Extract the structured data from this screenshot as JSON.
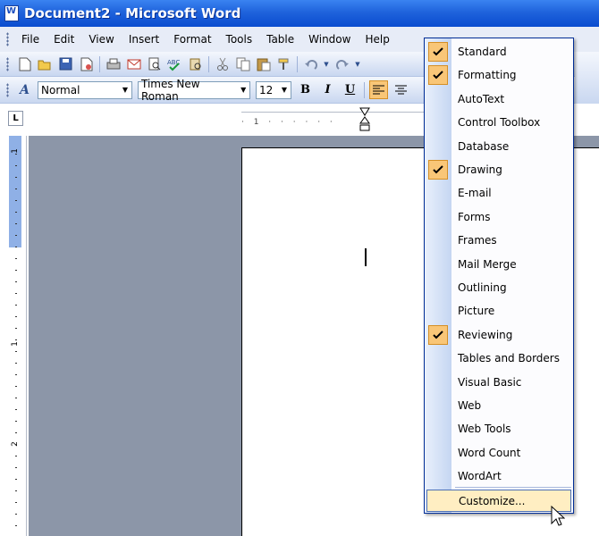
{
  "window": {
    "title": "Document2 - Microsoft Word"
  },
  "menubar": {
    "items": [
      "File",
      "Edit",
      "View",
      "Insert",
      "Format",
      "Tools",
      "Table",
      "Window",
      "Help"
    ]
  },
  "standard_toolbar": {
    "icons": [
      "new-icon",
      "open-icon",
      "save-icon",
      "permission-icon",
      "print-icon",
      "email-icon",
      "print-preview-icon",
      "spelling-icon",
      "research-icon",
      "cut-icon",
      "copy-icon",
      "paste-icon",
      "format-painter-icon",
      "undo-icon",
      "redo-icon"
    ]
  },
  "formatting_toolbar": {
    "style_value": "Normal",
    "font_value": "Times New Roman",
    "size_value": "12",
    "bold_label": "B",
    "italic_label": "I",
    "underline_label": "U"
  },
  "ruler": {
    "tab_selector": "L",
    "h_marks": "· 1 · · · · · ·",
    "v_numbers": [
      "1",
      "1",
      "2"
    ]
  },
  "toolbar_menu": {
    "items": [
      {
        "label": "Standard",
        "checked": true
      },
      {
        "label": "Formatting",
        "checked": true
      },
      {
        "label": "AutoText",
        "checked": false
      },
      {
        "label": "Control Toolbox",
        "checked": false
      },
      {
        "label": "Database",
        "checked": false
      },
      {
        "label": "Drawing",
        "checked": true
      },
      {
        "label": "E-mail",
        "checked": false
      },
      {
        "label": "Forms",
        "checked": false
      },
      {
        "label": "Frames",
        "checked": false
      },
      {
        "label": "Mail Merge",
        "checked": false
      },
      {
        "label": "Outlining",
        "checked": false
      },
      {
        "label": "Picture",
        "checked": false
      },
      {
        "label": "Reviewing",
        "checked": true
      },
      {
        "label": "Tables and Borders",
        "checked": false
      },
      {
        "label": "Visual Basic",
        "checked": false
      },
      {
        "label": "Web",
        "checked": false
      },
      {
        "label": "Web Tools",
        "checked": false
      },
      {
        "label": "Word Count",
        "checked": false
      },
      {
        "label": "WordArt",
        "checked": false
      }
    ],
    "customize_label": "Customize..."
  },
  "colors": {
    "title_bar": "#1f63dc",
    "highlight": "#f9c677",
    "workspace": "#8c96a8"
  }
}
